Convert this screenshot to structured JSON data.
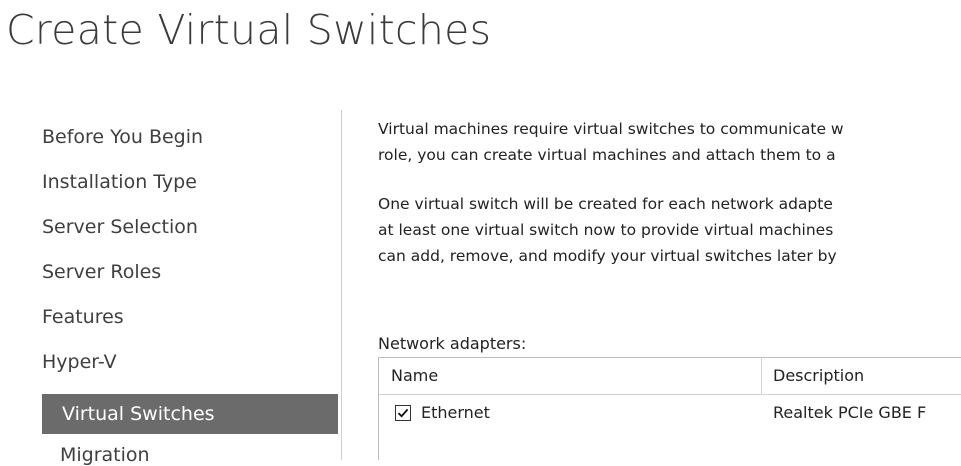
{
  "page": {
    "title": "Create Virtual Switches"
  },
  "nav": {
    "items": [
      {
        "label": "Before You Begin"
      },
      {
        "label": "Installation Type"
      },
      {
        "label": "Server Selection"
      },
      {
        "label": "Server Roles"
      },
      {
        "label": "Features"
      },
      {
        "label": "Hyper-V"
      },
      {
        "label": "Virtual Switches",
        "selected": true
      },
      {
        "label": "Migration"
      }
    ]
  },
  "content": {
    "paragraph1": {
      "line1": "Virtual machines require virtual switches to communicate w",
      "line2": "role, you can create virtual machines and attach them to a"
    },
    "paragraph2": {
      "line1": "One virtual switch will be created for each network adapte",
      "line2": "at least one virtual switch now to provide virtual machines",
      "line3": "can add, remove, and modify your virtual switches later by"
    },
    "adapters_label": "Network adapters:",
    "table": {
      "columns": [
        "Name",
        "Description"
      ],
      "rows": [
        {
          "checked": true,
          "name": "Ethernet",
          "description": "Realtek PCIe GBE F"
        }
      ]
    }
  },
  "colors": {
    "selected_bg": "#6b6b6b",
    "selected_text": "#ffffff",
    "title_text": "#3a3a3a"
  }
}
